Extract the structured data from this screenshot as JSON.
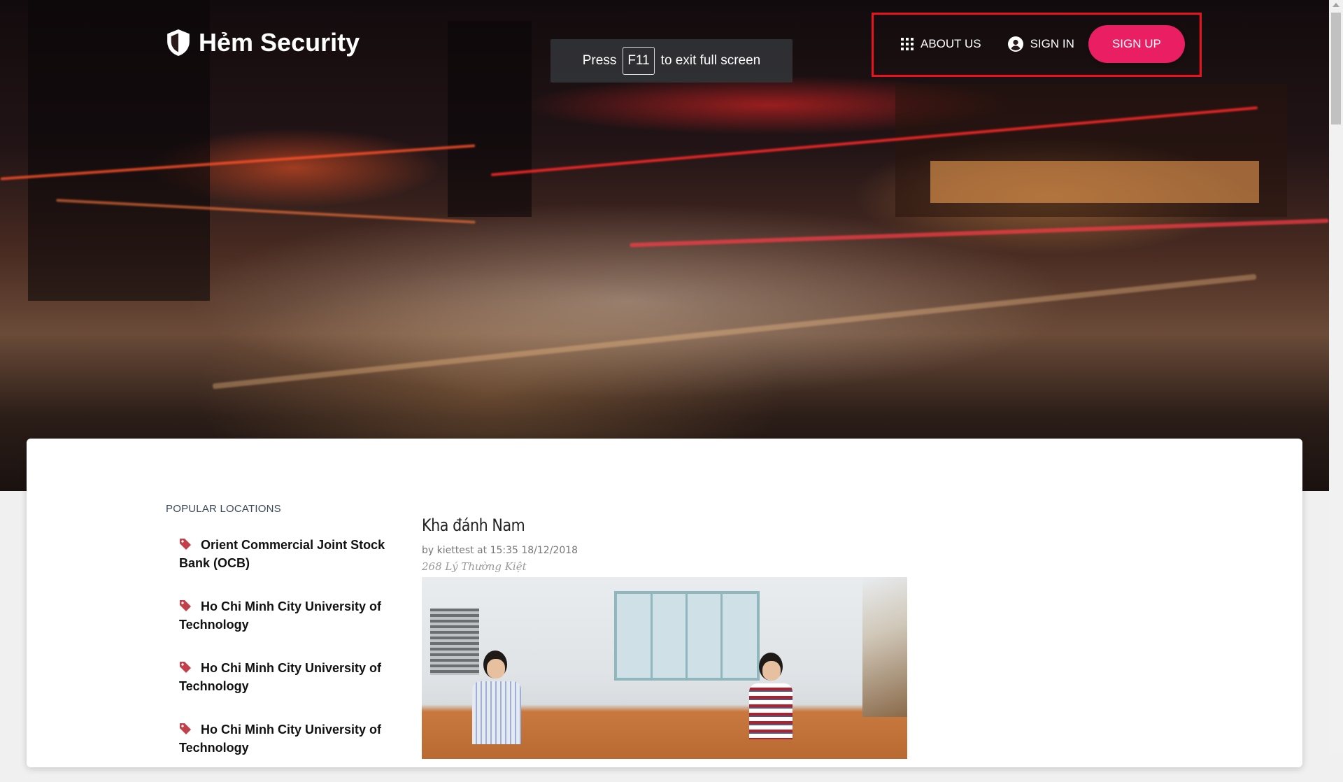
{
  "brand": {
    "name": "Hẻm Security",
    "icon": "shield-icon"
  },
  "fullscreen_notice": {
    "before": "Press",
    "key": "F11",
    "after": "to exit full screen"
  },
  "nav": {
    "about": {
      "label": "ABOUT US",
      "icon": "grid-icon"
    },
    "signin": {
      "label": "SIGN IN",
      "icon": "account-circle-icon"
    },
    "signup": {
      "label": "SIGN UP"
    }
  },
  "colors": {
    "accent": "#e91e63",
    "highlight_box": "#e8131f",
    "tag": "#c2404a"
  },
  "sidebar": {
    "title": "POPULAR LOCATIONS",
    "items": [
      {
        "label": "Orient Commercial Joint Stock Bank (OCB)",
        "icon": "tag-icon"
      },
      {
        "label": "Ho Chi Minh City University of Technology",
        "icon": "tag-icon"
      },
      {
        "label": "Ho Chi Minh City University of Technology",
        "icon": "tag-icon"
      },
      {
        "label": "Ho Chi Minh City University of Technology",
        "icon": "tag-icon"
      }
    ]
  },
  "post": {
    "title": "Kha đánh Nam",
    "meta": "by kiettest at 15:35 18/12/2018",
    "address": "268 Lý Thường Kiệt"
  }
}
